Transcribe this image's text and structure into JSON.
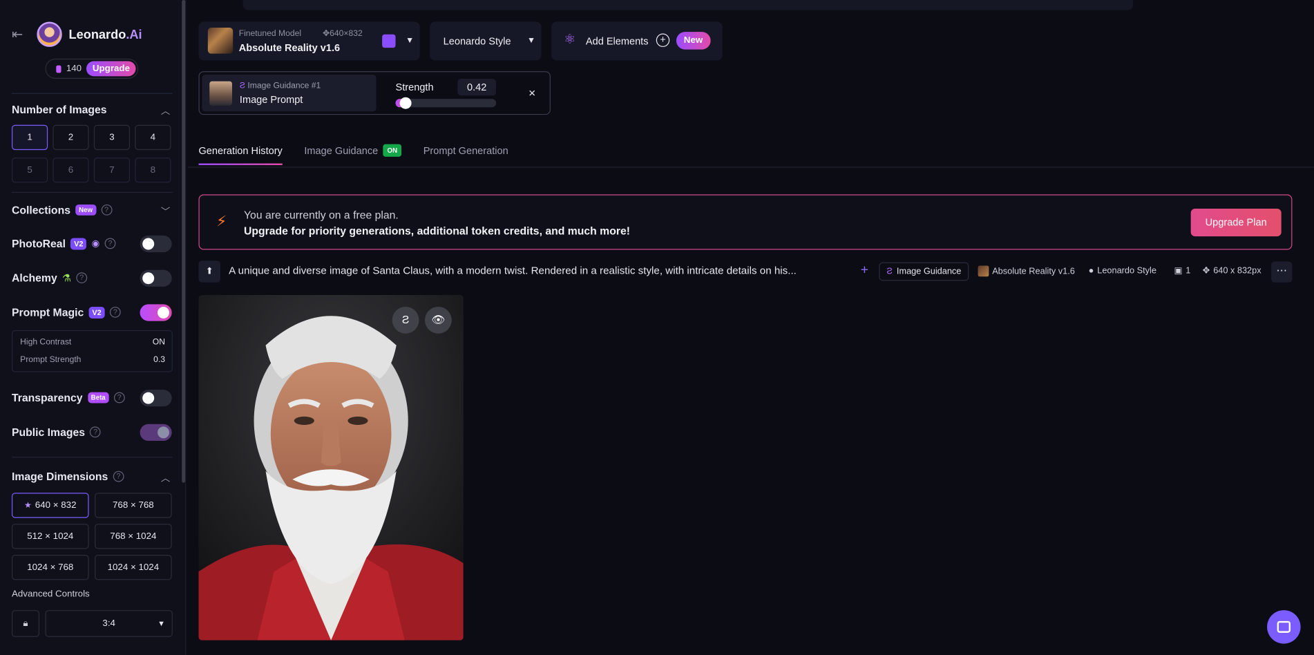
{
  "brand": {
    "name_part1": "Leonardo",
    "name_part2": ".Ai"
  },
  "tokens": {
    "count": "140",
    "upgrade_label": "Upgrade"
  },
  "sidebar": {
    "number_of_images": {
      "title": "Number of Images",
      "options": [
        "1",
        "2",
        "3",
        "4",
        "5",
        "6",
        "7",
        "8"
      ],
      "selected": "1"
    },
    "collections": {
      "title": "Collections",
      "badge": "New"
    },
    "photoreal": {
      "title": "PhotoReal",
      "badge": "V2",
      "enabled": false
    },
    "alchemy": {
      "title": "Alchemy",
      "enabled": false
    },
    "prompt_magic": {
      "title": "Prompt Magic",
      "badge": "V2",
      "enabled": true,
      "high_contrast_label": "High Contrast",
      "high_contrast_value": "ON",
      "prompt_strength_label": "Prompt Strength",
      "prompt_strength_value": "0.3"
    },
    "transparency": {
      "title": "Transparency",
      "badge": "Beta",
      "enabled": false
    },
    "public_images": {
      "title": "Public Images",
      "enabled": true
    },
    "image_dimensions": {
      "title": "Image Dimensions",
      "options": [
        "640 × 832",
        "768 × 768",
        "512 × 1024",
        "768 × 1024",
        "1024 × 768",
        "1024 × 1024"
      ],
      "selected": "640 × 832"
    },
    "advanced_controls": {
      "label": "Advanced Controls",
      "ratio": "3:4"
    }
  },
  "model": {
    "sub_label": "Finetuned Model",
    "dims": "640×832",
    "name": "Absolute Reality v1.6"
  },
  "style": {
    "label": "Leonardo Style"
  },
  "elements": {
    "label": "Add Elements",
    "badge": "New"
  },
  "guidance": {
    "sub_label": "Image Guidance #1",
    "name": "Image Prompt",
    "strength_label": "Strength",
    "strength_value": "0.42",
    "strength_fraction": 0.1
  },
  "tabs": [
    {
      "label": "Generation History",
      "active": true
    },
    {
      "label": "Image Guidance",
      "badge": "ON"
    },
    {
      "label": "Prompt Generation"
    }
  ],
  "banner": {
    "line1": "You are currently on a free plan.",
    "line2": "Upgrade for priority generations, additional token credits, and much more!",
    "button": "Upgrade Plan"
  },
  "generation": {
    "prompt": "A unique and diverse image of Santa Claus, with a modern twist. Rendered in a realistic style, with intricate details on his...",
    "guidance_tag": "Image Guidance",
    "model_tag": "Absolute Reality v1.6",
    "style_tag": "Leonardo Style",
    "count_tag": "1",
    "dims_tag": "640 x 832px"
  },
  "colors": {
    "accent_purple": "#9b4dff",
    "accent_pink": "#e24ba8",
    "background": "#0b0c14",
    "on_green": "#15a84a"
  }
}
